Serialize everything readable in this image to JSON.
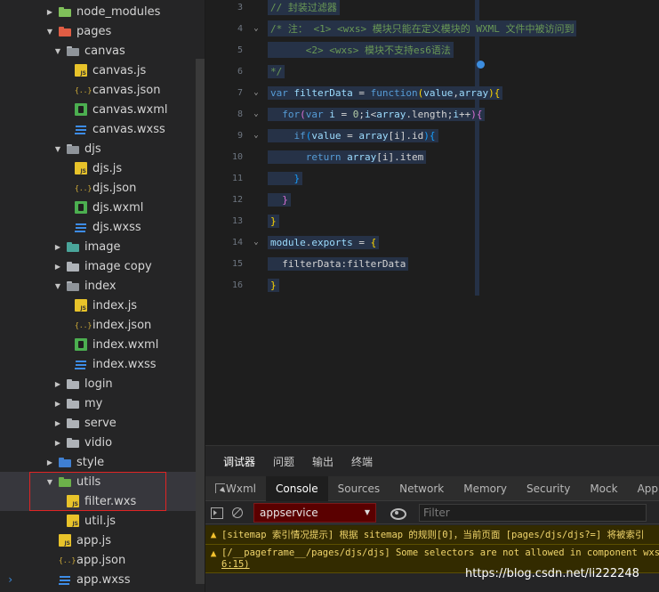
{
  "sidebar": {
    "rows": [
      {
        "label": "node_modules",
        "depth": 0,
        "icon": "folder-node-icon",
        "arrow": "collapsed"
      },
      {
        "label": "pages",
        "depth": 0,
        "icon": "folder-pages-icon",
        "arrow": "expanded"
      },
      {
        "label": "canvas",
        "depth": 1,
        "icon": "folder-open-icon",
        "arrow": "expanded"
      },
      {
        "label": "canvas.js",
        "depth": 2,
        "icon": "js-file-icon"
      },
      {
        "label": "canvas.json",
        "depth": 2,
        "icon": "json-file-icon"
      },
      {
        "label": "canvas.wxml",
        "depth": 2,
        "icon": "wxml-file-icon"
      },
      {
        "label": "canvas.wxss",
        "depth": 2,
        "icon": "wxss-file-icon"
      },
      {
        "label": "djs",
        "depth": 1,
        "icon": "folder-open-icon",
        "arrow": "expanded"
      },
      {
        "label": "djs.js",
        "depth": 2,
        "icon": "js-file-icon"
      },
      {
        "label": "djs.json",
        "depth": 2,
        "icon": "json-file-icon"
      },
      {
        "label": "djs.wxml",
        "depth": 2,
        "icon": "wxml-file-icon"
      },
      {
        "label": "djs.wxss",
        "depth": 2,
        "icon": "wxss-file-icon"
      },
      {
        "label": "image",
        "depth": 1,
        "icon": "folder-image-icon",
        "arrow": "collapsed"
      },
      {
        "label": "image copy",
        "depth": 1,
        "icon": "folder-icon",
        "arrow": "collapsed"
      },
      {
        "label": "index",
        "depth": 1,
        "icon": "folder-open-icon",
        "arrow": "expanded"
      },
      {
        "label": "index.js",
        "depth": 2,
        "icon": "js-file-icon"
      },
      {
        "label": "index.json",
        "depth": 2,
        "icon": "json-file-icon"
      },
      {
        "label": "index.wxml",
        "depth": 2,
        "icon": "wxml-file-icon"
      },
      {
        "label": "index.wxss",
        "depth": 2,
        "icon": "wxss-file-icon"
      },
      {
        "label": "login",
        "depth": 1,
        "icon": "folder-icon",
        "arrow": "collapsed"
      },
      {
        "label": "my",
        "depth": 1,
        "icon": "folder-icon",
        "arrow": "collapsed"
      },
      {
        "label": "serve",
        "depth": 1,
        "icon": "folder-icon",
        "arrow": "collapsed"
      },
      {
        "label": "vidio",
        "depth": 1,
        "icon": "folder-icon",
        "arrow": "collapsed"
      },
      {
        "label": "style",
        "depth": 0,
        "icon": "folder-style-icon",
        "arrow": "collapsed"
      },
      {
        "label": "utils",
        "depth": 0,
        "icon": "folder-utils-icon",
        "arrow": "expanded",
        "selected": true
      },
      {
        "label": "filter.wxs",
        "depth": 1,
        "icon": "wxs-file-icon",
        "selected": true
      },
      {
        "label": "util.js",
        "depth": 1,
        "icon": "js-file-icon"
      },
      {
        "label": "app.js",
        "depth": 0,
        "icon": "js-file-icon"
      },
      {
        "label": "app.json",
        "depth": 0,
        "icon": "json-file-icon"
      },
      {
        "label": "app.wxss",
        "depth": 0,
        "icon": "wxss-file-icon"
      }
    ]
  },
  "editor": {
    "lines": [
      {
        "n": "3",
        "fold": "",
        "tokens": [
          [
            "c-comment",
            "// 封装过滤器"
          ]
        ]
      },
      {
        "n": "4",
        "fold": "v",
        "tokens": [
          [
            "c-comment",
            "/* 注： <1> <wxs> 模块只能在定义模块的 WXML 文件中被访问到"
          ]
        ]
      },
      {
        "n": "5",
        "fold": "",
        "tokens": [
          [
            "c-comment",
            "      <2> <wxs> 模块不支持es6语法"
          ]
        ]
      },
      {
        "n": "6",
        "fold": "",
        "tokens": [
          [
            "c-comment",
            "*/"
          ]
        ]
      },
      {
        "n": "7",
        "fold": "v",
        "tokens": [
          [
            "c-kw",
            "var "
          ],
          [
            "c-var",
            "filterData"
          ],
          [
            "c-punc",
            " = "
          ],
          [
            "c-kw",
            "function"
          ],
          [
            "c-brace",
            "("
          ],
          [
            "c-var",
            "value"
          ],
          [
            "c-punc",
            ","
          ],
          [
            "c-var",
            "array"
          ],
          [
            "c-brace",
            ")"
          ],
          [
            "c-brace",
            "{"
          ]
        ]
      },
      {
        "n": "8",
        "fold": "v",
        "tokens": [
          [
            "c-punc",
            "  "
          ],
          [
            "c-kw",
            "for"
          ],
          [
            "c-brace2",
            "("
          ],
          [
            "c-kw",
            "var "
          ],
          [
            "c-var",
            "i"
          ],
          [
            "c-punc",
            " = "
          ],
          [
            "c-num",
            "0"
          ],
          [
            "c-punc",
            ";"
          ],
          [
            "c-var",
            "i"
          ],
          [
            "c-punc",
            "<"
          ],
          [
            "c-var",
            "array"
          ],
          [
            "c-punc",
            ".length;"
          ],
          [
            "c-var",
            "i"
          ],
          [
            "c-punc",
            "++"
          ],
          [
            "c-brace2",
            ")"
          ],
          [
            "c-brace2",
            "{"
          ]
        ]
      },
      {
        "n": "9",
        "fold": "v",
        "tokens": [
          [
            "c-punc",
            "    "
          ],
          [
            "c-kw",
            "if"
          ],
          [
            "c-brace3",
            "("
          ],
          [
            "c-var",
            "value"
          ],
          [
            "c-punc",
            " = "
          ],
          [
            "c-var",
            "array"
          ],
          [
            "c-punc",
            "[i].id"
          ],
          [
            "c-brace3",
            ")"
          ],
          [
            "c-brace3",
            "{"
          ]
        ]
      },
      {
        "n": "10",
        "fold": "",
        "tokens": [
          [
            "c-punc",
            "      "
          ],
          [
            "c-kw",
            "return "
          ],
          [
            "c-var",
            "array"
          ],
          [
            "c-punc",
            "[i].item"
          ]
        ]
      },
      {
        "n": "11",
        "fold": "",
        "tokens": [
          [
            "c-punc",
            "    "
          ],
          [
            "c-brace3",
            "}"
          ]
        ]
      },
      {
        "n": "12",
        "fold": "",
        "tokens": [
          [
            "c-punc",
            "  "
          ],
          [
            "c-brace2",
            "}"
          ]
        ]
      },
      {
        "n": "13",
        "fold": "",
        "tokens": [
          [
            "c-brace",
            "}"
          ]
        ]
      },
      {
        "n": "14",
        "fold": "v",
        "tokens": [
          [
            "c-var",
            "module"
          ],
          [
            "c-punc",
            "."
          ],
          [
            "c-var",
            "exports"
          ],
          [
            "c-punc",
            " = "
          ],
          [
            "c-brace",
            "{"
          ]
        ]
      },
      {
        "n": "15",
        "fold": "",
        "tokens": [
          [
            "c-punc",
            "  filterData:filterData"
          ]
        ]
      },
      {
        "n": "16",
        "fold": "",
        "tokens": [
          [
            "c-brace",
            "}"
          ]
        ]
      }
    ]
  },
  "devtools": {
    "panel_tabs": [
      "调试器",
      "问题",
      "输出",
      "终端"
    ],
    "console_tabs": [
      "Wxml",
      "Console",
      "Sources",
      "Network",
      "Memory",
      "Security",
      "Mock",
      "AppData"
    ],
    "active_console_tab": "Console",
    "context": "appservice",
    "filter_placeholder": "Filter",
    "messages": [
      {
        "text": "[sitemap 索引情况提示] 根据 sitemap 的规则[0]，当前页面 [pages/djs/djs?=] 将被索引"
      },
      {
        "text": "[/__pageframe__/pages/djs/djs] Some selectors are not allowed in component wxss",
        "text2": "6:15)"
      }
    ],
    "prompt": "›"
  },
  "watermark": "https://blog.csdn.net/li222248",
  "colors": {
    "editor_bg": "#1e1e1e",
    "sidebar_bg": "#252526",
    "selection": "#263247",
    "warning_bg": "#332b00",
    "highlight_box": "#e02424"
  }
}
